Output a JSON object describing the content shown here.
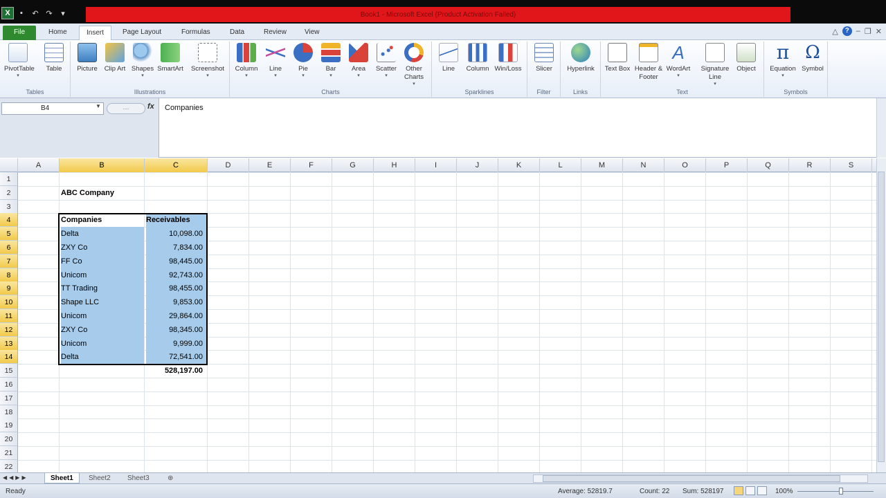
{
  "window": {
    "title": "Book1 - Microsoft Excel (Product Activation Failed)"
  },
  "tabs": {
    "file": "File",
    "home": "Home",
    "insert": "Insert",
    "page_layout": "Page Layout",
    "formulas": "Formulas",
    "data": "Data",
    "review": "Review",
    "view": "View"
  },
  "ribbon": {
    "tables": {
      "label": "Tables",
      "pivottable": "PivotTable",
      "table": "Table"
    },
    "illustrations": {
      "label": "Illustrations",
      "picture": "Picture",
      "clip_art": "Clip Art",
      "shapes": "Shapes",
      "smartart": "SmartArt",
      "screenshot": "Screenshot"
    },
    "charts": {
      "label": "Charts",
      "column": "Column",
      "line": "Line",
      "pie": "Pie",
      "bar": "Bar",
      "area": "Area",
      "scatter": "Scatter",
      "other": "Other Charts"
    },
    "sparklines": {
      "label": "Sparklines",
      "line": "Line",
      "column": "Column",
      "winloss": "Win/Loss"
    },
    "filter": {
      "label": "Filter",
      "slicer": "Slicer"
    },
    "links": {
      "label": "Links",
      "hyperlink": "Hyperlink"
    },
    "text": {
      "label": "Text",
      "text_box": "Text Box",
      "header_footer": "Header & Footer",
      "wordart": "WordArt",
      "signature_line": "Signature Line",
      "object": "Object"
    },
    "symbols": {
      "label": "Symbols",
      "equation": "Equation",
      "symbol": "Symbol"
    }
  },
  "formula_bar": {
    "name_box": "B4",
    "fx": "fx",
    "value": "Companies"
  },
  "grid": {
    "columns": [
      "A",
      "B",
      "C",
      "D",
      "E",
      "F",
      "G",
      "H",
      "I",
      "J",
      "K",
      "L",
      "M",
      "N",
      "O",
      "P",
      "Q",
      "R",
      "S"
    ],
    "rows": [
      "1",
      "2",
      "3",
      "4",
      "5",
      "6",
      "7",
      "8",
      "9",
      "10",
      "11",
      "12",
      "13",
      "14",
      "15",
      "16",
      "17",
      "18",
      "19",
      "20",
      "21",
      "22"
    ],
    "company_title": "ABC Company",
    "header_companies": "Companies",
    "header_receivables": "Receivables",
    "records": [
      {
        "company": "Delta",
        "amount": "10,098.00"
      },
      {
        "company": "ZXY Co",
        "amount": "7,834.00"
      },
      {
        "company": "FF Co",
        "amount": "98,445.00"
      },
      {
        "company": "Unicom",
        "amount": "92,743.00"
      },
      {
        "company": "TT Trading",
        "amount": "98,455.00"
      },
      {
        "company": "Shape LLC",
        "amount": "9,853.00"
      },
      {
        "company": "Unicom",
        "amount": "29,864.00"
      },
      {
        "company": "ZXY Co",
        "amount": "98,345.00"
      },
      {
        "company": "Unicom",
        "amount": "9,999.00"
      },
      {
        "company": "Delta",
        "amount": "72,541.00"
      }
    ],
    "total": "528,197.00"
  },
  "sheets": [
    "Sheet1",
    "Sheet2",
    "Sheet3"
  ],
  "status": {
    "ready": "Ready",
    "average": "Average: 52819.7",
    "count": "Count: 22",
    "sum": "Sum: 528197",
    "zoom": "100%"
  },
  "colors": {
    "accent": "#e0161b",
    "selection": "#a6cbeb",
    "file_tab": "#2f8a2f"
  }
}
